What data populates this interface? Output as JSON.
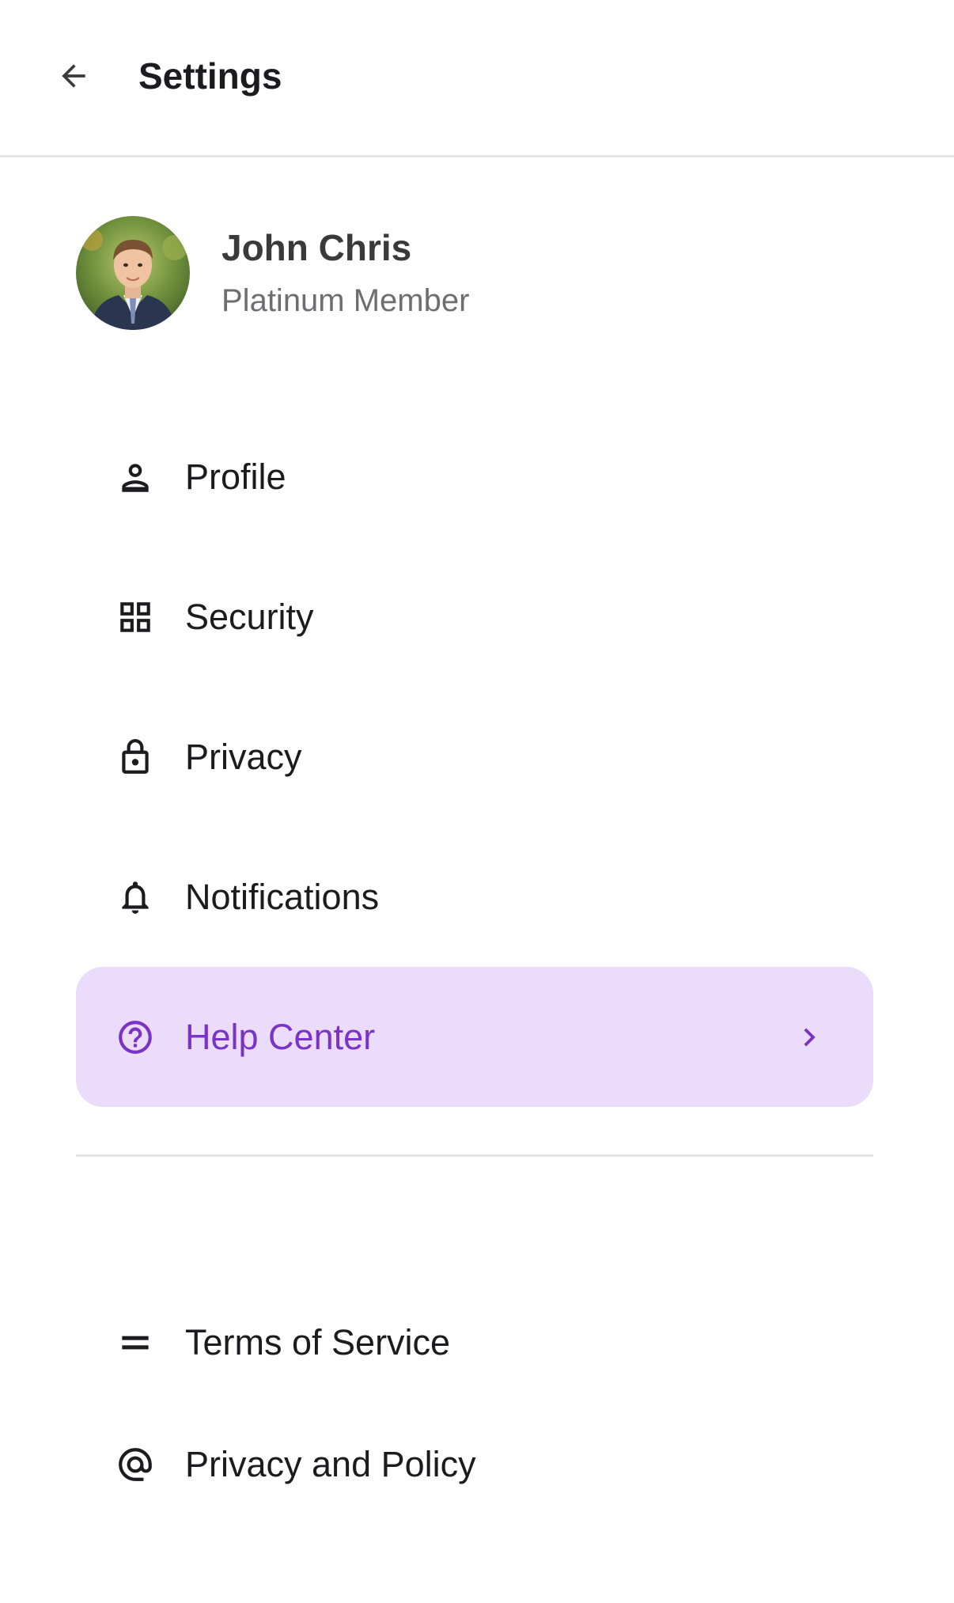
{
  "header": {
    "title": "Settings",
    "back_icon": "arrow-left-icon"
  },
  "user": {
    "name": "John Chris",
    "tier": "Platinum Member"
  },
  "menu": [
    {
      "label": "Profile",
      "icon": "person-icon"
    },
    {
      "label": "Security",
      "icon": "grid-icon"
    },
    {
      "label": "Privacy",
      "icon": "lock-icon"
    },
    {
      "label": "Notifications",
      "icon": "bell-icon"
    },
    {
      "label": "Help Center",
      "icon": "help-circle-icon",
      "active": true
    }
  ],
  "legal": [
    {
      "label": "Terms of Service",
      "icon": "equals-icon"
    },
    {
      "label": "Privacy and Policy",
      "icon": "at-icon"
    }
  ],
  "colors": {
    "accent": "#7a33c7",
    "active_bg": "#eadcfa",
    "divider": "#e4e4e6"
  }
}
